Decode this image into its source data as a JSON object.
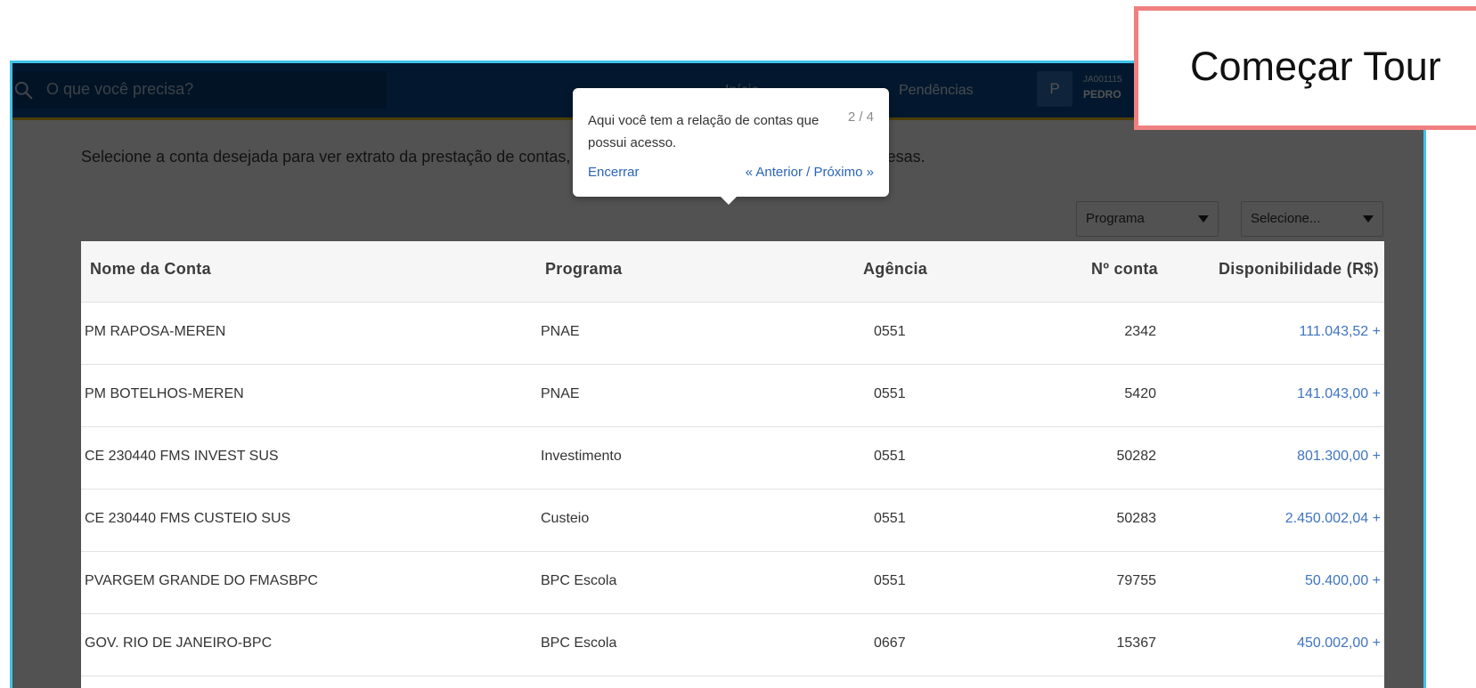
{
  "search": {
    "placeholder": "O que você precisa?"
  },
  "nav": {
    "inicio": "Início",
    "pendencias": "Pendências"
  },
  "user": {
    "avatar_letter": "P",
    "code": "JA001115",
    "name": "PEDRO"
  },
  "page": {
    "description": "Selecione a conta desejada para ver extrato da prestação de contas, resumo financeiro e detalhamento das despesas."
  },
  "filters": {
    "programa": {
      "selected": "Programa"
    },
    "account": {
      "selected": "Selecione..."
    }
  },
  "table": {
    "headers": {
      "name": "Nome da Conta",
      "programa": "Programa",
      "agencia": "Agência",
      "numero": "Nº conta",
      "disponibilidade": "Disponibilidade (R$)"
    },
    "rows": [
      {
        "name": "PM RAPOSA-MEREN",
        "programa": "PNAE",
        "agencia": "0551",
        "numero": "2342",
        "disponibilidade": "111.043,52 +"
      },
      {
        "name": "PM BOTELHOS-MEREN",
        "programa": "PNAE",
        "agencia": "0551",
        "numero": "5420",
        "disponibilidade": "141.043,00 +"
      },
      {
        "name": "CE 230440 FMS INVEST SUS",
        "programa": "Investimento",
        "agencia": "0551",
        "numero": "50282",
        "disponibilidade": "801.300,00 +"
      },
      {
        "name": "CE 230440 FMS CUSTEIO SUS",
        "programa": "Custeio",
        "agencia": "0551",
        "numero": "50283",
        "disponibilidade": "2.450.002,04 +"
      },
      {
        "name": "PVARGEM GRANDE DO FMASBPC",
        "programa": "BPC Escola",
        "agencia": "0551",
        "numero": "79755",
        "disponibilidade": "50.400,00 +"
      },
      {
        "name": "GOV. RIO DE JANEIRO-BPC",
        "programa": "BPC Escola",
        "agencia": "0667",
        "numero": "15367",
        "disponibilidade": "450.002,00 +"
      }
    ]
  },
  "tour": {
    "text": "Aqui você tem a relação de contas que possui acesso.",
    "step": "2 / 4",
    "end_label": "Encerrar",
    "prev_label": "« Anterior",
    "separator": "/",
    "next_label": "Próximo »",
    "start_label": "Começar Tour"
  },
  "colors": {
    "topbar": "#0a4d8f",
    "accent_bar": "#e9c216",
    "frame_border": "#3ec3ea",
    "callout_border": "#f08080",
    "link": "#2a64b8",
    "amount": "#3f74c0"
  }
}
